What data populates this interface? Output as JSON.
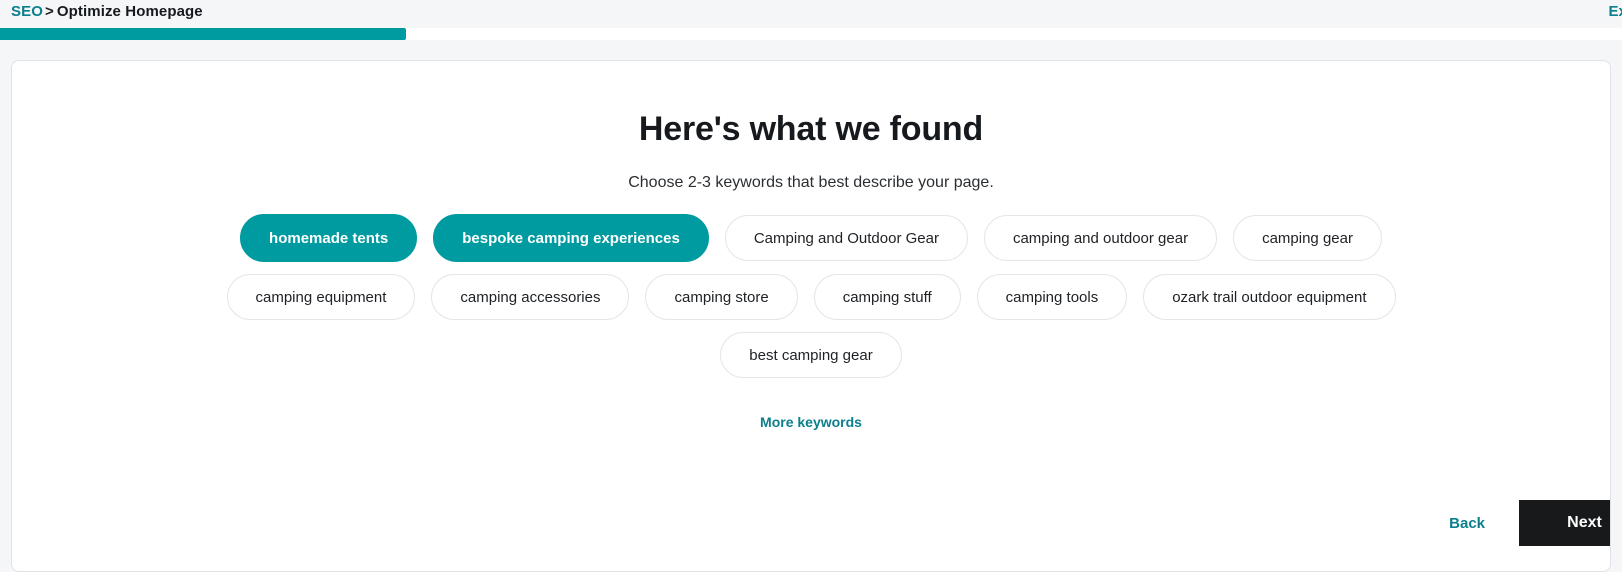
{
  "header": {
    "breadcrumb_root": "SEO",
    "breadcrumb_separator": ">",
    "breadcrumb_current": "Optimize Homepage",
    "exit_label": "Exit",
    "progress_percent": 25
  },
  "main": {
    "title": "Here's what we found",
    "subtitle": "Choose 2-3 keywords that best describe your page.",
    "more_keywords_label": "More keywords",
    "keyword_rows": [
      [
        {
          "label": "homemade tents",
          "selected": true
        },
        {
          "label": "bespoke camping experiences",
          "selected": true
        },
        {
          "label": "Camping and Outdoor Gear",
          "selected": false
        },
        {
          "label": "camping and outdoor gear",
          "selected": false
        },
        {
          "label": "camping gear",
          "selected": false
        }
      ],
      [
        {
          "label": "camping equipment",
          "selected": false
        },
        {
          "label": "camping accessories",
          "selected": false
        },
        {
          "label": "camping store",
          "selected": false
        },
        {
          "label": "camping stuff",
          "selected": false
        },
        {
          "label": "camping tools",
          "selected": false
        },
        {
          "label": "ozark trail outdoor equipment",
          "selected": false
        }
      ],
      [
        {
          "label": "best camping gear",
          "selected": false
        }
      ]
    ]
  },
  "footer": {
    "back_label": "Back",
    "next_label": "Next"
  },
  "colors": {
    "accent_teal": "#009ba0",
    "link_teal": "#0b7f8c",
    "next_button_bg": "#17191b",
    "page_bg": "#f4f6f8",
    "chip_border": "#e3e6ea"
  }
}
